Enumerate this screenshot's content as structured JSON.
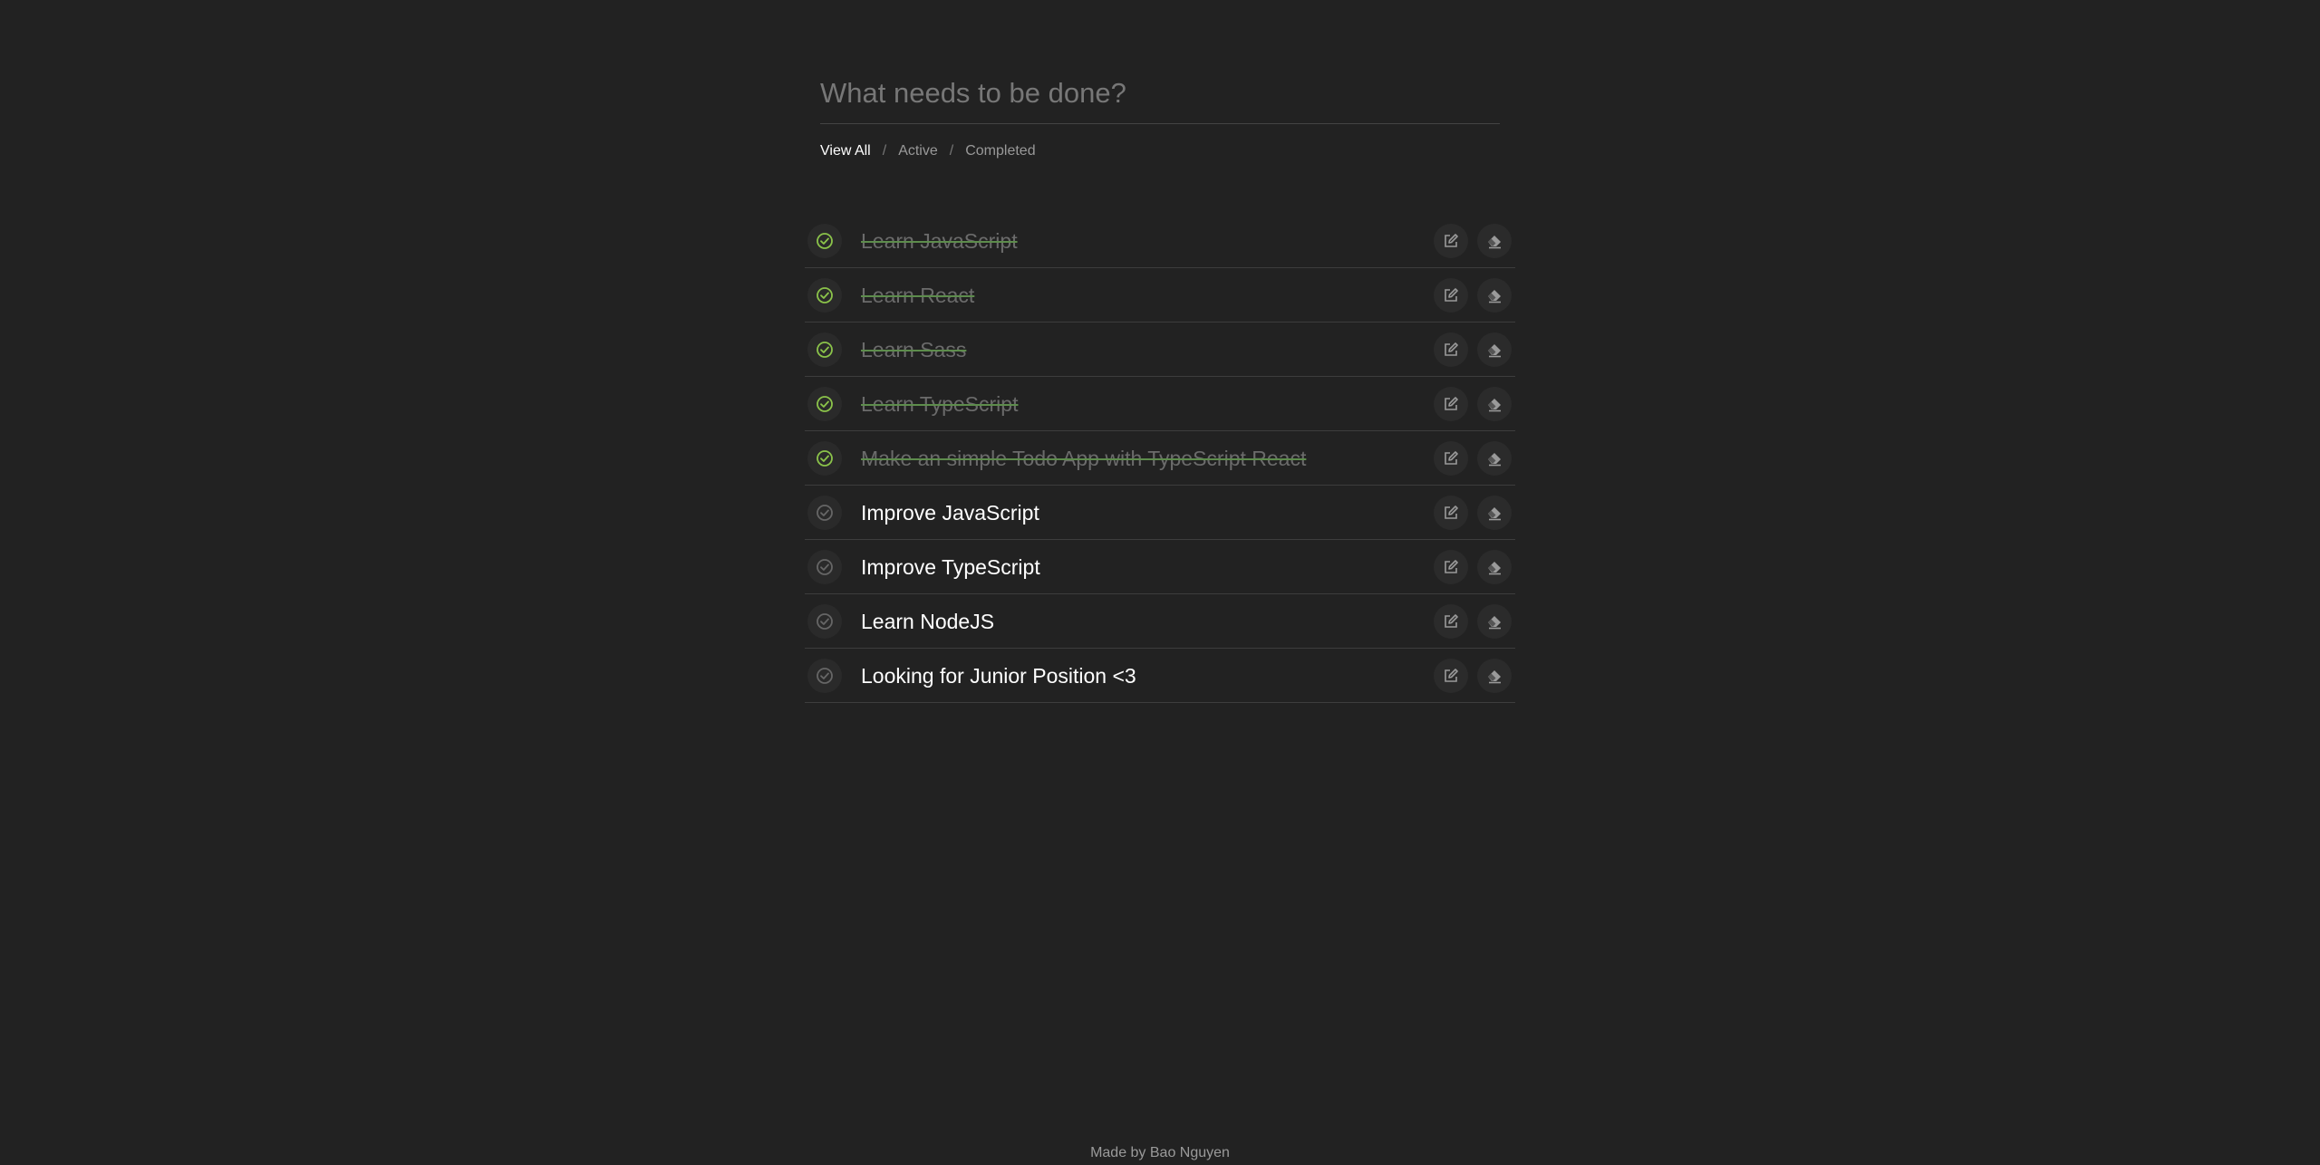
{
  "input": {
    "placeholder": "What needs to be done?"
  },
  "filters": {
    "all": "View All",
    "active": "Active",
    "completed": "Completed",
    "separator": "/"
  },
  "todos": [
    {
      "text": "Learn JavaScript",
      "completed": true
    },
    {
      "text": "Learn React",
      "completed": true
    },
    {
      "text": "Learn Sass",
      "completed": true
    },
    {
      "text": "Learn TypeScript",
      "completed": true
    },
    {
      "text": "Make an simple Todo App with TypeScript React",
      "completed": true
    },
    {
      "text": "Improve JavaScript",
      "completed": false
    },
    {
      "text": "Improve TypeScript",
      "completed": false
    },
    {
      "text": "Learn NodeJS",
      "completed": false
    },
    {
      "text": "Looking for Junior Position <3",
      "completed": false
    }
  ],
  "icons": {
    "check": "check-circle-icon",
    "edit": "edit-icon",
    "erase": "eraser-icon"
  },
  "colors": {
    "background": "#222222",
    "done_check": "#8bc34a",
    "pending_check": "#666666",
    "icon": "#9a9a9a"
  },
  "footer": {
    "credit": "Made by Bao Nguyen"
  }
}
